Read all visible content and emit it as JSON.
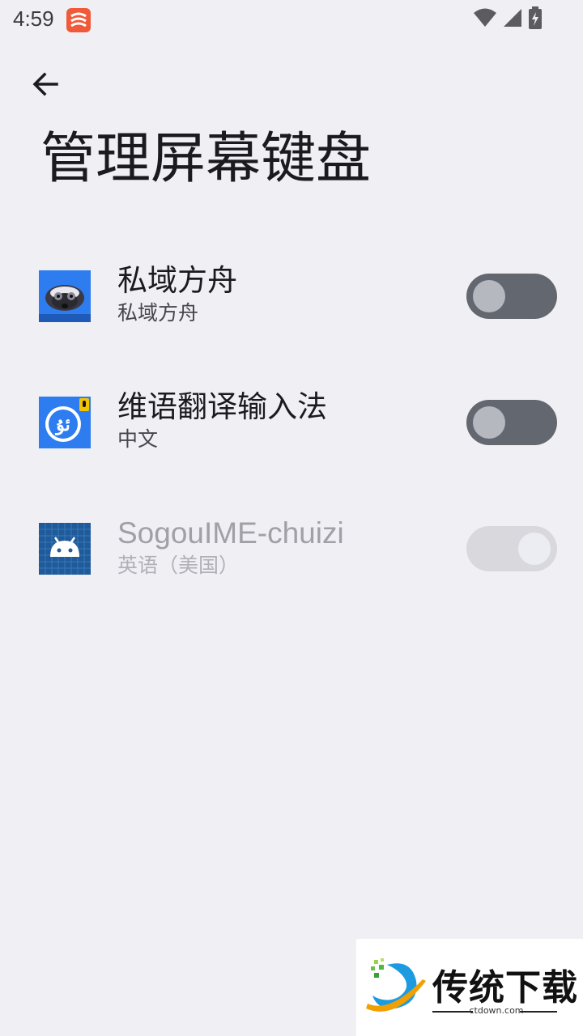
{
  "status_bar": {
    "time": "4:59",
    "icons": [
      "app-notification-icon",
      "wifi-icon",
      "cell-signal-icon",
      "battery-charging-icon"
    ]
  },
  "header": {
    "back_icon": "arrow-back-icon",
    "title": "管理屏幕键盘"
  },
  "keyboards": [
    {
      "title": "私域方舟",
      "subtitle": "私域方舟",
      "icon": "badger-app-icon",
      "toggle": "off",
      "enabled": true
    },
    {
      "title": "维语翻译输入法",
      "subtitle": "中文",
      "icon": "uyghur-translate-app-icon",
      "toggle": "off",
      "enabled": true
    },
    {
      "title": "SogouIME-chuizi",
      "subtitle": "英语（美国）",
      "icon": "android-app-icon",
      "toggle": "on",
      "enabled": false
    }
  ],
  "watermark": {
    "title": "传统下载",
    "url": "ctdown.com"
  },
  "colors": {
    "background": "#f0eff4",
    "toggle_off_track": "#636770",
    "toggle_disabled_track": "#d9d9dd",
    "app_icon_blue": "#2d7cf0"
  }
}
